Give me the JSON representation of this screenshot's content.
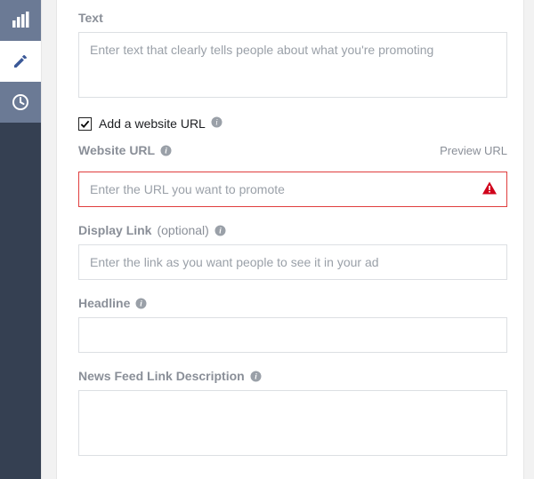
{
  "sidebar": {
    "items": [
      {
        "name": "performance",
        "icon": "bar-chart-icon",
        "active": false
      },
      {
        "name": "edit",
        "icon": "pencil-icon",
        "active": true
      },
      {
        "name": "history",
        "icon": "clock-icon",
        "active": false
      }
    ]
  },
  "form": {
    "text": {
      "label": "Text",
      "placeholder": "Enter text that clearly tells people about what you're promoting",
      "value": ""
    },
    "add_url_checkbox": {
      "label": "Add a website URL",
      "checked": true
    },
    "website_url": {
      "label": "Website URL",
      "preview_link": "Preview URL",
      "placeholder": "Enter the URL you want to promote",
      "value": "",
      "error": true
    },
    "display_link": {
      "label": "Display Link",
      "optional": "(optional)",
      "placeholder": "Enter the link as you want people to see it in your ad",
      "value": ""
    },
    "headline": {
      "label": "Headline",
      "placeholder": "",
      "value": ""
    },
    "news_feed_desc": {
      "label": "News Feed Link Description",
      "placeholder": "",
      "value": ""
    }
  },
  "colors": {
    "sidebar_dark": "#354052",
    "sidebar_dim": "#6b7a95",
    "error": "#e03e3e",
    "label": "#8a8f98"
  }
}
